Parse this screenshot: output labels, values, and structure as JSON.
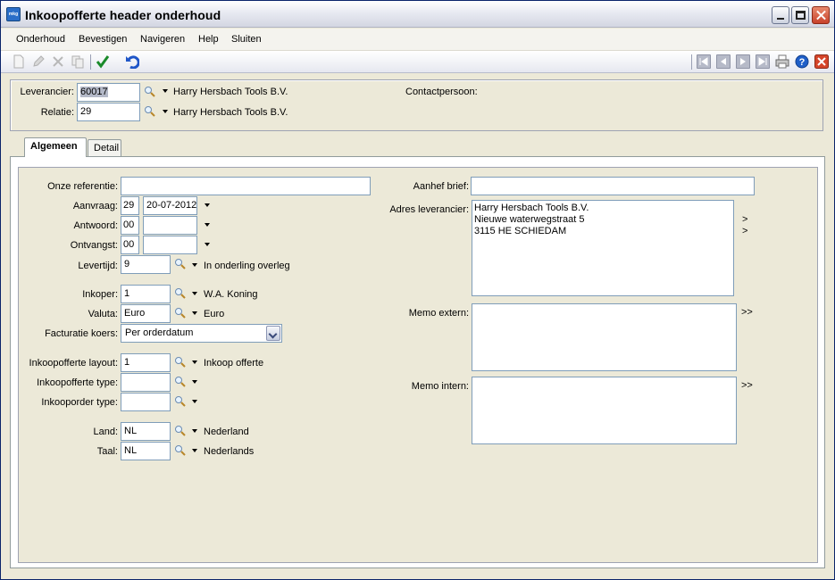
{
  "window": {
    "title": "Inkoopofferte header onderhoud",
    "app_icon_text": "mkg"
  },
  "menu": [
    {
      "label": "Onderhoud"
    },
    {
      "label": "Bevestigen"
    },
    {
      "label": "Navigeren"
    },
    {
      "label": "Help"
    },
    {
      "label": "Sluiten"
    }
  ],
  "header": {
    "leverancier": {
      "label": "Leverancier:",
      "value": "60017",
      "name": "Harry Hersbach Tools B.V."
    },
    "relatie": {
      "label": "Relatie:",
      "value": "29",
      "name": "Harry Hersbach Tools B.V."
    },
    "contactpersoon": {
      "label": "Contactpersoon:"
    }
  },
  "tabs": [
    {
      "label": "Algemeen",
      "active": true
    },
    {
      "label": "Detail",
      "active": false
    }
  ],
  "form": {
    "onze_referentie": {
      "label": "Onze referentie:",
      "value": ""
    },
    "aanvraag": {
      "label": "Aanvraag:",
      "week": "29",
      "date": "20-07-2012"
    },
    "antwoord": {
      "label": "Antwoord:",
      "week": "00",
      "date": ""
    },
    "ontvangst": {
      "label": "Ontvangst:",
      "week": "00",
      "date": ""
    },
    "levertijd": {
      "label": "Levertijd:",
      "value": "9",
      "desc": "In onderling overleg"
    },
    "inkoper": {
      "label": "Inkoper:",
      "value": "1",
      "desc": "W.A. Koning"
    },
    "valuta": {
      "label": "Valuta:",
      "value": "Euro",
      "desc": "Euro"
    },
    "facturatie_koers": {
      "label": "Facturatie koers:",
      "value": "Per orderdatum"
    },
    "inkoopofferte_layout": {
      "label": "Inkoopofferte layout:",
      "value": "1",
      "desc": "Inkoop offerte"
    },
    "inkoopofferte_type": {
      "label": "Inkoopofferte type:",
      "value": ""
    },
    "inkooporder_type": {
      "label": "Inkooporder type:",
      "value": ""
    },
    "land": {
      "label": "Land:",
      "value": "NL",
      "desc": "Nederland"
    },
    "taal": {
      "label": "Taal:",
      "value": "NL",
      "desc": "Nederlands"
    },
    "aanhef_brief": {
      "label": "Aanhef brief:",
      "value": ""
    },
    "adres_leverancier": {
      "label": "Adres leverancier:",
      "lines": [
        "Harry Hersbach Tools B.V.",
        "Nieuwe waterwegstraat 5",
        "3115 HE SCHIEDAM"
      ]
    },
    "memo_extern": {
      "label": "Memo extern:",
      "expand": ">>"
    },
    "memo_intern": {
      "label": "Memo intern:",
      "expand": ">>"
    },
    "address_arrows": [
      ">",
      ">"
    ]
  }
}
